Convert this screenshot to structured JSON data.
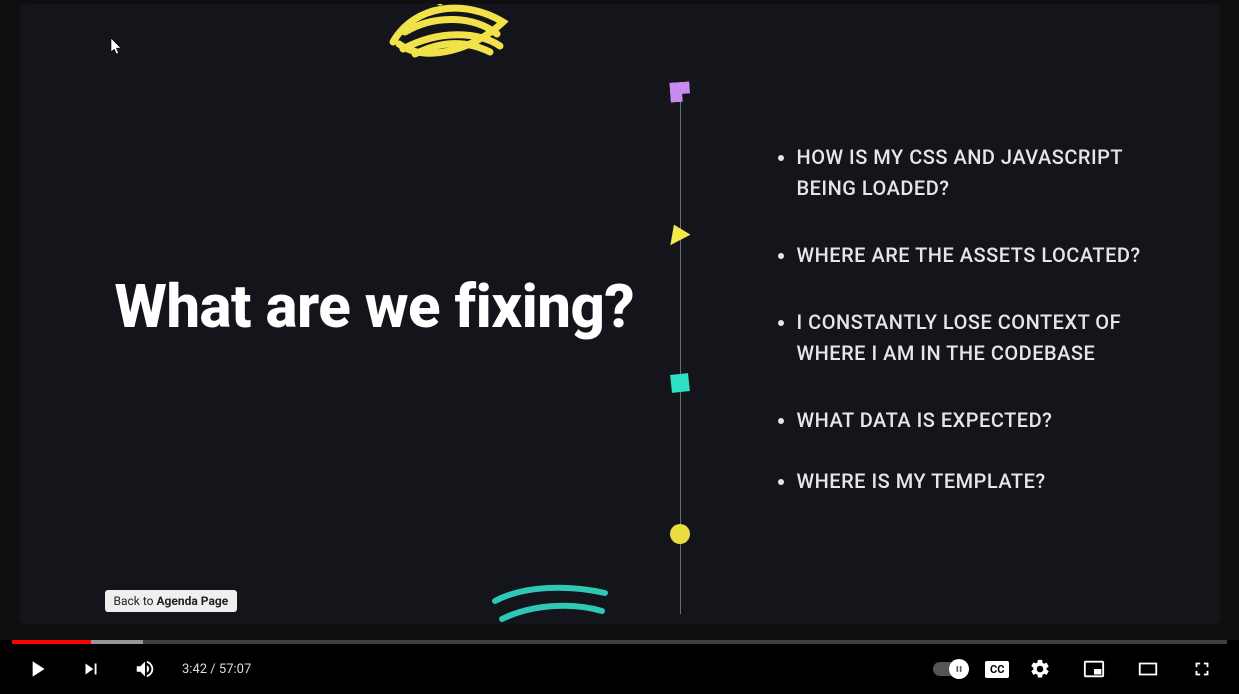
{
  "slide": {
    "heading": "What are we fixing?",
    "bullets": [
      "HOW IS MY CSS AND JAVASCRIPT BEING LOADED?",
      "WHERE ARE THE ASSETS LOCATED?",
      "I CONSTANTLY LOSE CONTEXT OF WHERE I AM IN THE CODEBASE",
      "WHAT DATA IS EXPECTED?",
      "WHERE IS MY TEMPLATE?"
    ],
    "back_button_prefix": "Back to ",
    "back_button_bold": "Agenda Page"
  },
  "player": {
    "current_time": "3:42",
    "duration": "57:07",
    "time_separator": " / ",
    "cc_label": "CC"
  }
}
